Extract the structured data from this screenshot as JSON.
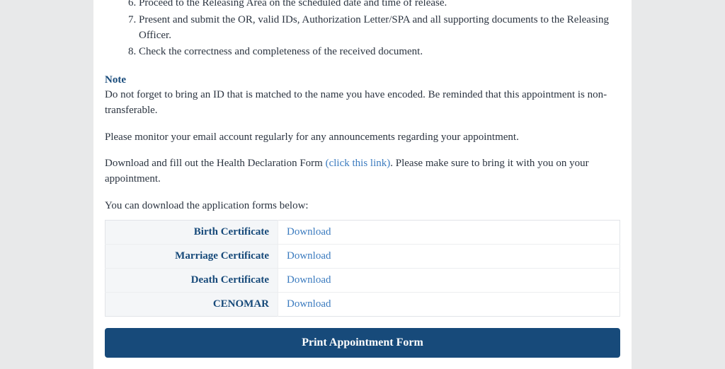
{
  "steps": [
    "Proceed to the Releasing Area on the scheduled date and time of release.",
    "Present and submit the OR, valid IDs, Authorization Letter/SPA and all supporting documents to the Releasing Officer.",
    "Check the correctness and completeness of the received document."
  ],
  "note": {
    "heading": "Note",
    "text": "Do not forget to bring an ID that is matched to the name you have encoded. Be reminded that this appointment is non-transferable."
  },
  "monitor_text": "Please monitor your email account regularly for any announcements regarding your appointment.",
  "health_form": {
    "prefix": "Download and fill out the Health Declaration Form ",
    "link_text": "(click this link)",
    "suffix": ". Please make sure to bring it with you on your appointment."
  },
  "forms_intro": "You can download the application forms below:",
  "forms": [
    {
      "label": "Birth Certificate",
      "action": "Download"
    },
    {
      "label": "Marriage Certificate",
      "action": "Download"
    },
    {
      "label": "Death Certificate",
      "action": "Download"
    },
    {
      "label": "CENOMAR",
      "action": "Download"
    }
  ],
  "print_button": "Print Appointment Form"
}
